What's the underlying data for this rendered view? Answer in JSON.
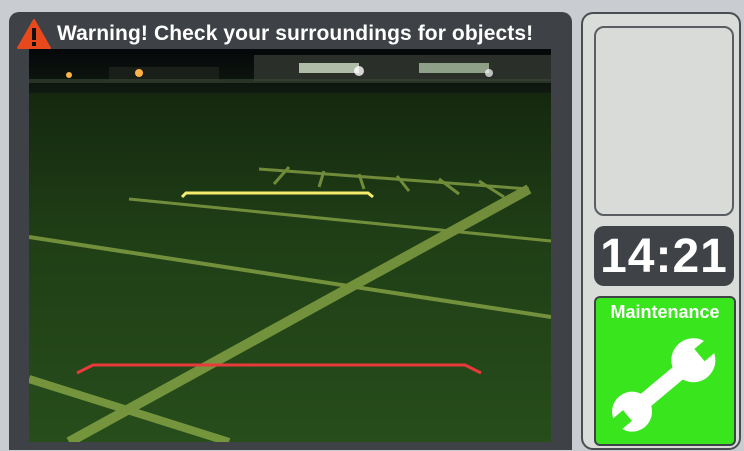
{
  "warning": {
    "text": "Warning! Check your surroundings for objects!",
    "icon": "warning-triangle-icon",
    "icon_color": "#e8491c"
  },
  "camera": {
    "guide_lines": [
      {
        "name": "far-guide-line",
        "color": "#f5ec6e"
      },
      {
        "name": "near-guide-line",
        "color": "#e83a3a"
      }
    ]
  },
  "sidebar": {
    "clock": "14:21",
    "maintenance": {
      "label": "Maintenance",
      "icon": "wrench-icon",
      "color": "#39e61e"
    }
  }
}
